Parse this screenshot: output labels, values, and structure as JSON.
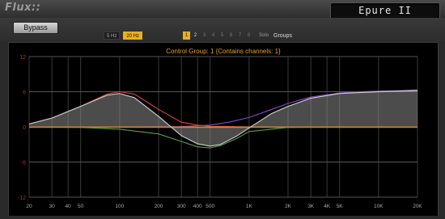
{
  "window": {
    "brand": "Flux::",
    "plugin_name": "Epure II"
  },
  "toolbar": {
    "bypass_label": "Bypass",
    "resolution": [
      {
        "label": "5 Hz",
        "active": false
      },
      {
        "label": "20 Hz",
        "active": true
      }
    ],
    "channels": [
      {
        "label": "1",
        "active": true
      },
      {
        "label": "2",
        "active": false
      },
      {
        "label": "3",
        "active": false
      },
      {
        "label": "4",
        "active": false
      },
      {
        "label": "5",
        "active": false
      },
      {
        "label": "6",
        "active": false
      },
      {
        "label": "7",
        "active": false
      },
      {
        "label": "8",
        "active": false
      }
    ],
    "solo_label": "Solo",
    "groups_label": "Groups"
  },
  "graph": {
    "caption": "Control Group: 1 {Contains channels: 1}",
    "y_ticks": [
      "12",
      "6",
      "0",
      "-6",
      "-12"
    ],
    "x_ticks": [
      "20",
      "30",
      "40",
      "50",
      "100",
      "200",
      "300",
      "400",
      "500",
      "1K",
      "2K",
      "3K",
      "4K",
      "5K",
      "10K",
      "20K"
    ],
    "colors": {
      "total": "#c8c8c8",
      "band_low": "#e04040",
      "band_mid": "#5aa040",
      "band_high": "#8a4ac8",
      "band_flat": "#e08020",
      "band_flat2": "#c8c040",
      "grid": "#3a3a3a",
      "caption": "#e8a020",
      "tick": "#b0302a"
    }
  },
  "chart_data": {
    "type": "line",
    "xscale": "log",
    "xlim": [
      20,
      20000
    ],
    "ylim": [
      -12,
      12
    ],
    "xlabel": "",
    "ylabel": "",
    "series": [
      {
        "name": "",
        "x": [
          20,
          30,
          50,
          80,
          100,
          130,
          200,
          300,
          400,
          500,
          700,
          1000,
          2000,
          5000,
          10000,
          20000
        ],
        "y": [
          0.5,
          1.5,
          3.5,
          5.6,
          6.0,
          5.6,
          3.0,
          0.8,
          0.3,
          0.1,
          0.05,
          0,
          0,
          0,
          0,
          0
        ]
      },
      {
        "name": "",
        "x": [
          20,
          50,
          100,
          200,
          300,
          400,
          500,
          600,
          800,
          1000,
          2000,
          5000,
          20000
        ],
        "y": [
          0,
          -0.1,
          -0.4,
          -1.2,
          -2.5,
          -3.4,
          -3.6,
          -3.2,
          -2.0,
          -0.8,
          -0.1,
          0,
          0
        ]
      },
      {
        "name": "",
        "x": [
          20,
          100,
          300,
          500,
          700,
          1000,
          1500,
          2000,
          3000,
          5000,
          7000,
          10000,
          15000,
          20000
        ],
        "y": [
          0,
          0,
          0.05,
          0.3,
          0.8,
          1.6,
          3.0,
          4.0,
          5.1,
          5.8,
          6.0,
          6.1,
          6.2,
          6.3
        ]
      },
      {
        "name": "",
        "x": [
          20,
          20000
        ],
        "y": [
          0,
          0
        ]
      },
      {
        "name": "",
        "x": [
          20,
          30,
          50,
          80,
          100,
          130,
          200,
          300,
          400,
          500,
          600,
          800,
          1000,
          1500,
          2000,
          3000,
          5000,
          10000,
          20000
        ],
        "y": [
          0.5,
          1.5,
          3.5,
          5.4,
          5.7,
          5.0,
          1.8,
          -1.5,
          -2.9,
          -3.3,
          -3.0,
          -1.6,
          -0.2,
          2.3,
          3.5,
          4.9,
          5.7,
          6.0,
          6.2
        ]
      }
    ]
  }
}
